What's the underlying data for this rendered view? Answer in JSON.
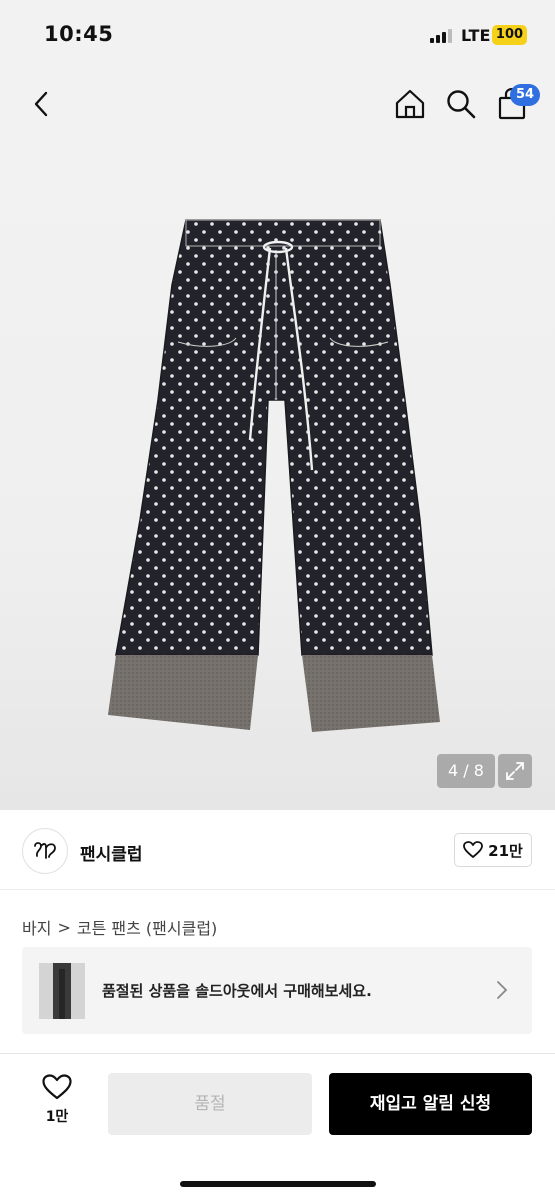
{
  "status_bar": {
    "time": "10:45",
    "network": "LTE",
    "battery": "100"
  },
  "nav": {
    "back_icon": "chevron-left-icon",
    "home_icon": "home-icon",
    "search_icon": "search-icon",
    "bag_icon": "shopping-bag-icon",
    "bag_badge": "54"
  },
  "product_image": {
    "counter": "4 / 8",
    "expand_icon": "expand-icon"
  },
  "brand": {
    "name": "팬시클럽",
    "logo_icon": "brand-logo-icon",
    "like_count": "21만"
  },
  "breadcrumb": {
    "category": "바지",
    "separator": ">",
    "product": "코튼 팬츠 (팬시클럽)"
  },
  "banner": {
    "text": "품절된 상품을 솔드아웃에서 구매해보세요.",
    "chevron_icon": "chevron-right-icon"
  },
  "bottom_bar": {
    "heart_count": "1만",
    "soldout_label": "품절",
    "restock_label": "재입고 알림 신청"
  },
  "colors": {
    "badge": "#2f6fdf",
    "battery": "#f5d11a",
    "primary_button": "#000000",
    "disabled_button": "#ececec"
  }
}
